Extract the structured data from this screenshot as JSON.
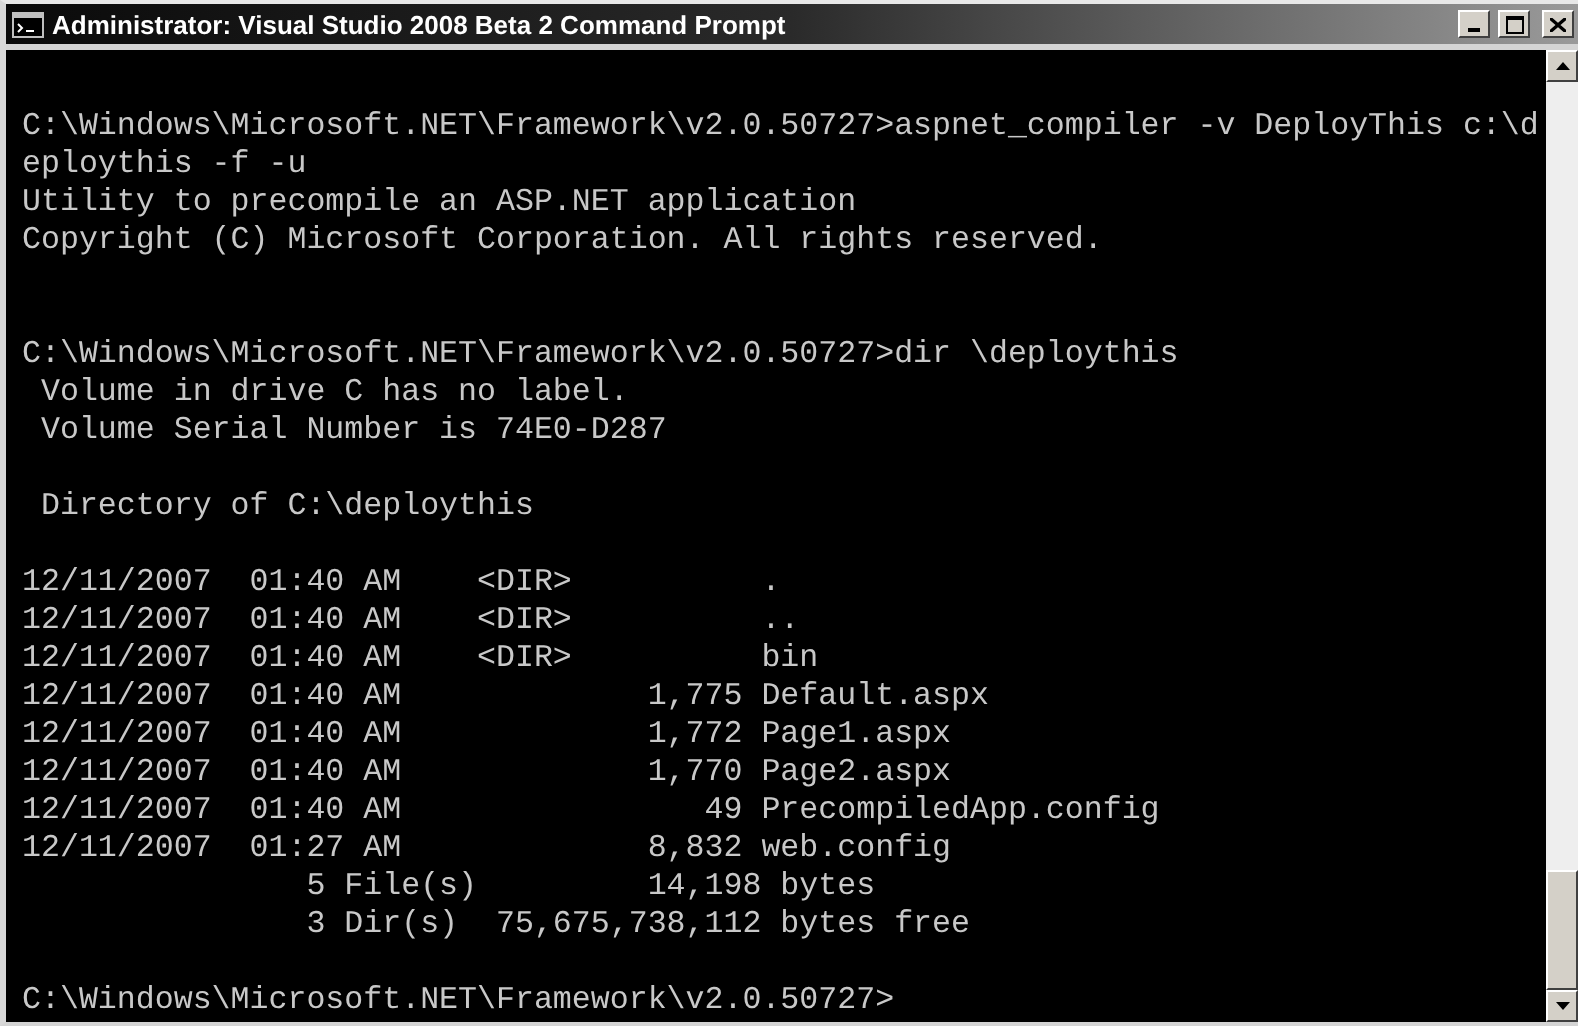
{
  "window": {
    "title": "Administrator: Visual Studio 2008 Beta 2 Command Prompt"
  },
  "console": {
    "lines": [
      {
        "kind": "blank"
      },
      {
        "kind": "text",
        "text": "C:\\Windows\\Microsoft.NET\\Framework\\v2.0.50727>aspnet_compiler -v DeployThis c:\\d"
      },
      {
        "kind": "text",
        "text": "eploythis -f -u"
      },
      {
        "kind": "text",
        "text": "Utility to precompile an ASP.NET application"
      },
      {
        "kind": "text",
        "text": "Copyright (C) Microsoft Corporation. All rights reserved."
      },
      {
        "kind": "blank"
      },
      {
        "kind": "blank"
      },
      {
        "kind": "text",
        "text": "C:\\Windows\\Microsoft.NET\\Framework\\v2.0.50727>dir \\deploythis"
      },
      {
        "kind": "text",
        "text": " Volume in drive C has no label."
      },
      {
        "kind": "text",
        "text": " Volume Serial Number is 74E0-D287"
      },
      {
        "kind": "blank"
      },
      {
        "kind": "text",
        "text": " Directory of C:\\deploythis"
      },
      {
        "kind": "blank"
      },
      {
        "kind": "text",
        "text": "12/11/2007  01:40 AM    <DIR>          ."
      },
      {
        "kind": "text",
        "text": "12/11/2007  01:40 AM    <DIR>          .."
      },
      {
        "kind": "text",
        "text": "12/11/2007  01:40 AM    <DIR>          bin"
      },
      {
        "kind": "text",
        "text": "12/11/2007  01:40 AM             1,775 Default.aspx"
      },
      {
        "kind": "text",
        "text": "12/11/2007  01:40 AM             1,772 Page1.aspx"
      },
      {
        "kind": "text",
        "text": "12/11/2007  01:40 AM             1,770 Page2.aspx"
      },
      {
        "kind": "text",
        "text": "12/11/2007  01:40 AM                49 PrecompiledApp.config"
      },
      {
        "kind": "text",
        "text": "12/11/2007  01:27 AM             8,832 web.config"
      },
      {
        "kind": "text",
        "text": "               5 File(s)         14,198 bytes"
      },
      {
        "kind": "text",
        "text": "               3 Dir(s)  75,675,738,112 bytes free"
      },
      {
        "kind": "blank"
      },
      {
        "kind": "text",
        "text": "C:\\Windows\\Microsoft.NET\\Framework\\v2.0.50727>"
      }
    ]
  }
}
